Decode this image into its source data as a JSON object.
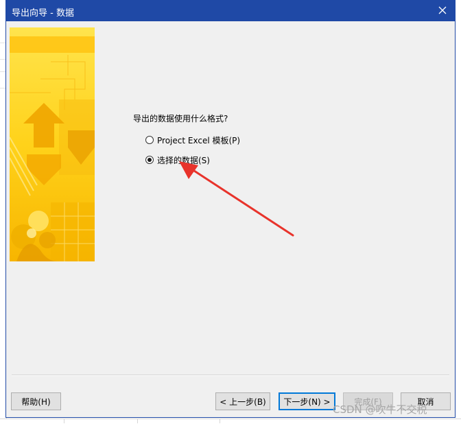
{
  "dialog": {
    "title": "导出向导 - 数据"
  },
  "main": {
    "question": "导出的数据使用什么格式?",
    "options": [
      {
        "label": "Project Excel 模板(P)",
        "checked": false
      },
      {
        "label": "选择的数据(S)",
        "checked": true
      }
    ]
  },
  "buttons": {
    "help": "帮助(H)",
    "back": "< 上一步(B)",
    "next": "下一步(N) >",
    "finish": "完成(F)",
    "cancel": "取消"
  },
  "watermark": "CSDN @吹牛不交税",
  "colors": {
    "titlebar": "#1f49a6",
    "dialog_bg": "#f0f0f0",
    "annotation_arrow": "#e8332b",
    "banner_yellow": "#ffd21a"
  }
}
